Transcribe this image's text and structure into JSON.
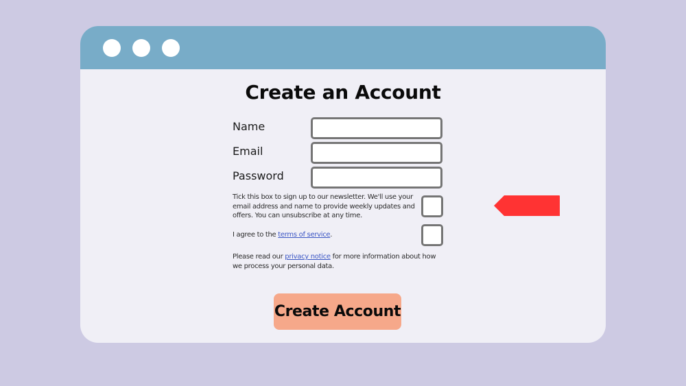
{
  "window": {
    "controls": [
      {
        "name": "window-dot-1"
      },
      {
        "name": "window-dot-2"
      },
      {
        "name": "window-dot-3"
      }
    ]
  },
  "form": {
    "title": "Create an Account",
    "fields": [
      {
        "label": "Name",
        "value": "",
        "placeholder": ""
      },
      {
        "label": "Email",
        "value": "",
        "placeholder": ""
      },
      {
        "label": "Password",
        "value": "",
        "placeholder": ""
      }
    ],
    "newsletter": {
      "text": "Tick this box to sign up to our newsletter. We'll use your email address and name to provide weekly updates and offers. You can unsubscribe at any time.",
      "checked": false
    },
    "terms": {
      "prefix": "I agree to the ",
      "link": "terms of service",
      "suffix": ".",
      "checked": false
    },
    "privacy": {
      "prefix": "Please read our ",
      "link": "privacy notice",
      "suffix": " for more information about how we process your personal data."
    },
    "submit_label": "Create Account"
  },
  "annotation": {
    "icon": "arrow-left-icon",
    "color": "#ff3333"
  },
  "colors": {
    "background": "#cdcae3",
    "titlebar": "#78acc8",
    "window": "#f0eff6",
    "button": "#f6a88a",
    "link": "#3a55c4"
  }
}
